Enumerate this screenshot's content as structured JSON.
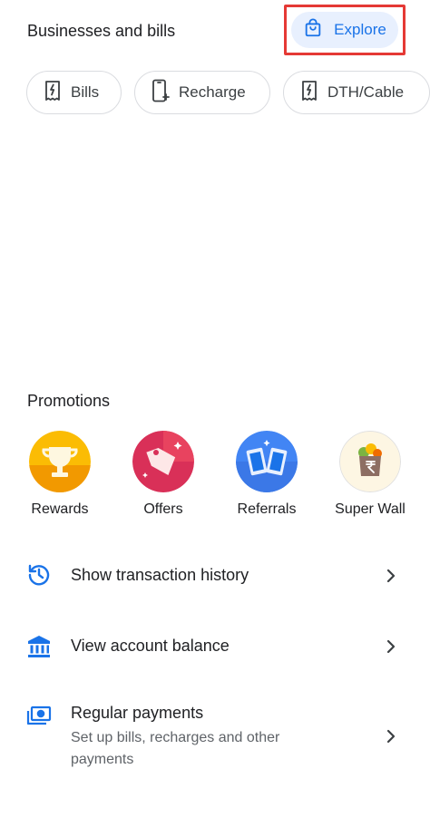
{
  "businesses": {
    "title": "Businesses and bills",
    "explore_label": "Explore",
    "chips": [
      {
        "label": "Bills",
        "icon": "bill-receipt-icon"
      },
      {
        "label": "Recharge",
        "icon": "phone-recharge-icon"
      },
      {
        "label": "DTH/Cable",
        "icon": "dth-receipt-icon"
      }
    ]
  },
  "promotions": {
    "title": "Promotions",
    "items": [
      {
        "label": "Rewards",
        "icon": "trophy-icon"
      },
      {
        "label": "Offers",
        "icon": "offer-tag-icon"
      },
      {
        "label": "Referrals",
        "icon": "referral-phones-icon"
      },
      {
        "label": "Super Wall",
        "icon": "rupee-bag-icon"
      }
    ]
  },
  "list": [
    {
      "title": "Show transaction history",
      "icon": "history-icon"
    },
    {
      "title": "View account balance",
      "icon": "bank-icon"
    },
    {
      "title": "Regular payments",
      "subtitle": "Set up bills, recharges and other payments",
      "icon": "payments-icon"
    }
  ],
  "colors": {
    "accent": "#1a73e8",
    "explore_bg": "#e8f0fe",
    "highlight_border": "#e53935",
    "chip_border": "#dadce0"
  }
}
